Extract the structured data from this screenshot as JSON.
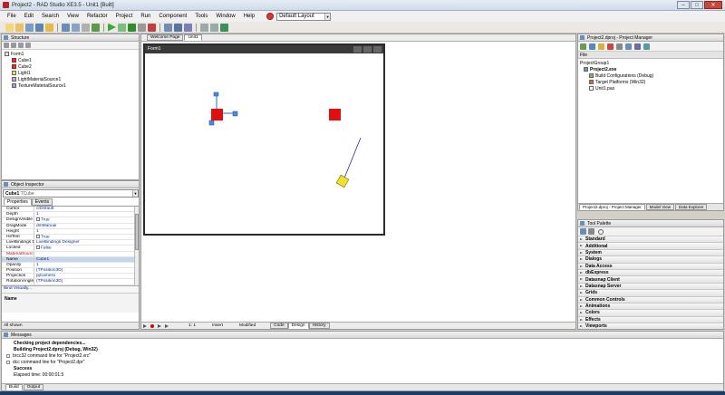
{
  "window": {
    "title": "Project2 - RAD Studio XE3.5 - Unit1 [Built]"
  },
  "menu": [
    "File",
    "Edit",
    "Search",
    "View",
    "Refactor",
    "Project",
    "Run",
    "Component",
    "Tools",
    "Window",
    "Help"
  ],
  "layout": {
    "selected": "Default Layout"
  },
  "structure": {
    "title": "Structure",
    "items": [
      {
        "label": "Form1",
        "level": 0
      },
      {
        "label": "Cube1",
        "level": 1
      },
      {
        "label": "Cube2",
        "level": 1
      },
      {
        "label": "Light1",
        "level": 1
      },
      {
        "label": "LightMaterialSource1",
        "level": 1
      },
      {
        "label": "TextureMaterialSource1",
        "level": 1
      }
    ]
  },
  "inspector": {
    "title": "Object Inspector",
    "object_name": "Cube1",
    "object_type": "TCube",
    "tabs": [
      "Properties",
      "Events"
    ],
    "rows": [
      {
        "key": "Cursor",
        "value": "crDefault"
      },
      {
        "key": "Depth",
        "value": "1"
      },
      {
        "key": "DesignVisible",
        "value": "True",
        "check": true
      },
      {
        "key": "DragMode",
        "value": "dmManual"
      },
      {
        "key": "Height",
        "value": "1"
      },
      {
        "key": "HitTest",
        "value": "True",
        "check": true
      },
      {
        "key": "LiveBindings Designer",
        "value": "LiveBindings Designer"
      },
      {
        "key": "Locked",
        "value": "False",
        "check": true
      },
      {
        "key": "MaterialSource",
        "value": "",
        "red": true
      },
      {
        "key": "Name",
        "value": "Cube1",
        "sel": true
      },
      {
        "key": "Opacity",
        "value": "1"
      },
      {
        "key": "Position",
        "value": "(TPosition3D)"
      },
      {
        "key": "Projection",
        "value": "pjCamera"
      },
      {
        "key": "RotationAngle",
        "value": "(TPosition3D)"
      }
    ],
    "bind_link": "Bind Visually...",
    "footer_label": "Name",
    "status": "All shown"
  },
  "designer": {
    "tabs": [
      "Welcome Page",
      "Unit1"
    ],
    "form_caption": "Form1",
    "status_pos": "1:   1",
    "status_mode": "Insert",
    "status_modified": "Modified",
    "view_tabs": [
      "Code",
      "Design",
      "History"
    ]
  },
  "project_manager": {
    "title": "Project2.dproj - Project Manager",
    "file_label": "File",
    "items": [
      {
        "label": "ProjectGroup1",
        "bold": false,
        "level": 0
      },
      {
        "label": "Project2.exe",
        "bold": true,
        "level": 1
      },
      {
        "label": "Build Configurations (Debug)",
        "bold": false,
        "level": 2
      },
      {
        "label": "Target Platforms (Win32)",
        "bold": false,
        "level": 2
      },
      {
        "label": "Unit1.pas",
        "bold": false,
        "level": 2
      }
    ],
    "bottom_tabs": [
      "Project2.dproj - Project Manager",
      "Model View",
      "Data Explorer"
    ]
  },
  "tool_palette": {
    "title": "Tool Palette",
    "categories": [
      "Standard",
      "Additional",
      "System",
      "Dialogs",
      "Data Access",
      "dbExpress",
      "Datasnap Client",
      "Datasnap Server",
      "Grids",
      "Common Controls",
      "Animations",
      "Colors",
      "Effects",
      "Viewports"
    ]
  },
  "messages": {
    "title": "Messages",
    "lines": [
      {
        "text": "Checking project dependencies...",
        "bold": true,
        "indent": 1
      },
      {
        "text": "Building Project2.dproj (Debug, Win32)",
        "bold": true,
        "indent": 1
      },
      {
        "text": "brcc32 command line for \"Project2.vrc\"",
        "bold": false,
        "indent": 0
      },
      {
        "text": "dcc command line for \"Project2.dpr\"",
        "bold": false,
        "indent": 0
      },
      {
        "text": "Success",
        "bold": true,
        "indent": 1
      },
      {
        "text": "Elapsed time: 00:00:01.5",
        "bold": false,
        "indent": 1
      }
    ],
    "tabs": [
      "Build",
      "Output"
    ]
  }
}
